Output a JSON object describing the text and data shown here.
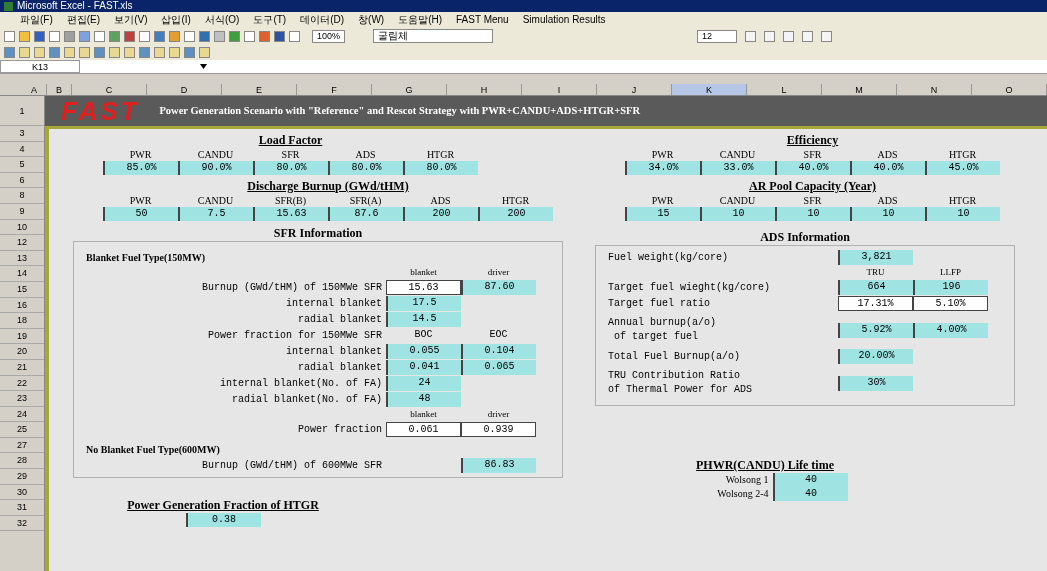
{
  "window": {
    "title": "Microsoft Excel - FAST.xls"
  },
  "menu": [
    "파일(F)",
    "편집(E)",
    "보기(V)",
    "삽입(I)",
    "서식(O)",
    "도구(T)",
    "데이터(D)",
    "창(W)",
    "도움말(H)",
    "FAST Menu",
    "Simulation Results"
  ],
  "toolbar": {
    "zoom": "100%",
    "font": "굴림체",
    "font_size": "12"
  },
  "name_box": "K13",
  "columns": [
    {
      "label": "A",
      "selected": false
    },
    {
      "label": "B",
      "selected": false
    },
    {
      "label": "C",
      "selected": false
    },
    {
      "label": "D",
      "selected": false
    },
    {
      "label": "E",
      "selected": false
    },
    {
      "label": "F",
      "selected": false
    },
    {
      "label": "G",
      "selected": false
    },
    {
      "label": "H",
      "selected": false
    },
    {
      "label": "I",
      "selected": false
    },
    {
      "label": "J",
      "selected": false
    },
    {
      "label": "K",
      "selected": true
    },
    {
      "label": "L",
      "selected": false
    },
    {
      "label": "M",
      "selected": false
    },
    {
      "label": "N",
      "selected": false
    },
    {
      "label": "O",
      "selected": false
    }
  ],
  "banner": {
    "logo": "FAST",
    "title": "Power Generation Scenario with \"Reference\" and Rescot Strategy with PWR+CANDU+ADS+HTGR+SFR"
  },
  "row_numbers": [
    "1",
    "3",
    "4",
    "5",
    "6",
    "8",
    "9",
    "10",
    "12",
    "13",
    "14",
    "15",
    "16",
    "18",
    "19",
    "20",
    "21",
    "22",
    "23",
    "24",
    "25",
    "27",
    "28",
    "29",
    "30",
    "31",
    "32"
  ],
  "load_factor": {
    "title": "Load Factor",
    "headers": [
      "PWR",
      "CANDU",
      "SFR",
      "ADS",
      "HTGR"
    ],
    "values": [
      "85.0%",
      "90.0%",
      "80.0%",
      "80.0%",
      "80.0%"
    ]
  },
  "discharge_burnup": {
    "title": "Discharge Burnup (GWd/tHM)",
    "headers": [
      "PWR",
      "CANDU",
      "SFR(B)",
      "SFR(A)",
      "ADS",
      "HTGR"
    ],
    "values": [
      "50",
      "7.5",
      "15.63",
      "87.6",
      "200",
      "200"
    ]
  },
  "efficiency": {
    "title": "Efficiency",
    "headers": [
      "PWR",
      "CANDU",
      "SFR",
      "ADS",
      "HTGR"
    ],
    "values": [
      "34.0%",
      "33.0%",
      "40.0%",
      "40.0%",
      "45.0%"
    ]
  },
  "ar_pool": {
    "title": "AR Pool Capacity (Year)",
    "headers": [
      "PWR",
      "CANDU",
      "SFR",
      "ADS",
      "HTGR"
    ],
    "values": [
      "15",
      "10",
      "10",
      "10",
      "10"
    ]
  },
  "sfr": {
    "title": "SFR Information",
    "rows": [
      {
        "kind": "heading",
        "label": "Blanket Fuel Type(150MW)"
      },
      {
        "kind": "header",
        "cells": [
          "blanket",
          "driver"
        ]
      },
      {
        "kind": "row",
        "label": "Burnup (GWd/tHM) of 150MWe SFR",
        "cells": [
          {
            "text": "15.63",
            "kind": "output"
          },
          {
            "text": "87.60",
            "kind": "input"
          }
        ]
      },
      {
        "kind": "row",
        "label": "internal blanket",
        "cells": [
          {
            "text": "17.5",
            "kind": "input"
          }
        ]
      },
      {
        "kind": "row",
        "label": "radial blanket",
        "cells": [
          {
            "text": "14.5",
            "kind": "input"
          }
        ]
      },
      {
        "kind": "row",
        "label": "Power fraction for 150MWe SFR",
        "cells": [
          {
            "text": "BOC",
            "kind": "label"
          },
          {
            "text": "EOC",
            "kind": "label"
          }
        ]
      },
      {
        "kind": "row",
        "label": "internal blanket",
        "cells": [
          {
            "text": "0.055",
            "kind": "input"
          },
          {
            "text": "0.104",
            "kind": "input"
          }
        ]
      },
      {
        "kind": "row",
        "label": "radial blanket",
        "cells": [
          {
            "text": "0.041",
            "kind": "input"
          },
          {
            "text": "0.065",
            "kind": "input"
          }
        ]
      },
      {
        "kind": "row",
        "label": "internal blanket(No. of FA)",
        "cells": [
          {
            "text": "24",
            "kind": "input"
          }
        ]
      },
      {
        "kind": "row",
        "label": "radial blanket(No. of FA)",
        "cells": [
          {
            "text": "48",
            "kind": "input"
          }
        ]
      },
      {
        "kind": "header",
        "cells": [
          "blanket",
          "driver"
        ]
      },
      {
        "kind": "row",
        "label": "Power fraction",
        "cells": [
          {
            "text": "0.061",
            "kind": "output"
          },
          {
            "text": "0.939",
            "kind": "output"
          }
        ]
      },
      {
        "kind": "heading",
        "label": "No Blanket Fuel Type(600MW)"
      },
      {
        "kind": "row",
        "label": "Burnup (GWd/tHM) of 600MWe SFR",
        "cells": [
          {
            "text": "",
            "kind": "empty"
          },
          {
            "text": "86.83",
            "kind": "input"
          }
        ]
      }
    ]
  },
  "ads": {
    "title": "ADS Information",
    "rows": [
      {
        "kind": "row",
        "label": "Fuel weight(kg/core)",
        "cells": [
          {
            "text": "3,821",
            "kind": "input"
          }
        ]
      },
      {
        "kind": "header",
        "cells": [
          "TRU",
          "LLFP"
        ]
      },
      {
        "kind": "row",
        "label": "Target fuel wieght(kg/core)",
        "cells": [
          {
            "text": "664",
            "kind": "input"
          },
          {
            "text": "196",
            "kind": "input"
          }
        ]
      },
      {
        "kind": "row",
        "label": "Target fuel ratio",
        "cells": [
          {
            "text": "17.31%",
            "kind": "output"
          },
          {
            "text": "5.10%",
            "kind": "output"
          }
        ]
      },
      {
        "kind": "row",
        "label": "Annual burnup(a/o)\n of target fuel",
        "cells": [
          {
            "text": "5.92%",
            "kind": "input"
          },
          {
            "text": "4.00%",
            "kind": "input"
          }
        ]
      },
      {
        "kind": "row",
        "label": "Total Fuel Burnup(a/o)",
        "cells": [
          {
            "text": "20.00%",
            "kind": "input"
          }
        ]
      },
      {
        "kind": "row",
        "label": "TRU Contribution Ratio\nof Thermal Power for ADS",
        "cells": [
          {
            "text": "30%",
            "kind": "input"
          }
        ]
      }
    ]
  },
  "htgr_fraction": {
    "title": "Power Generation Fraction of HTGR",
    "value": "0.38"
  },
  "phwr_lifetime": {
    "title": "PHWR(CANDU) Life time",
    "rows": [
      {
        "label": "Wolsong 1",
        "value": "40"
      },
      {
        "label": "Wolsong 2-4",
        "value": "40"
      }
    ]
  }
}
